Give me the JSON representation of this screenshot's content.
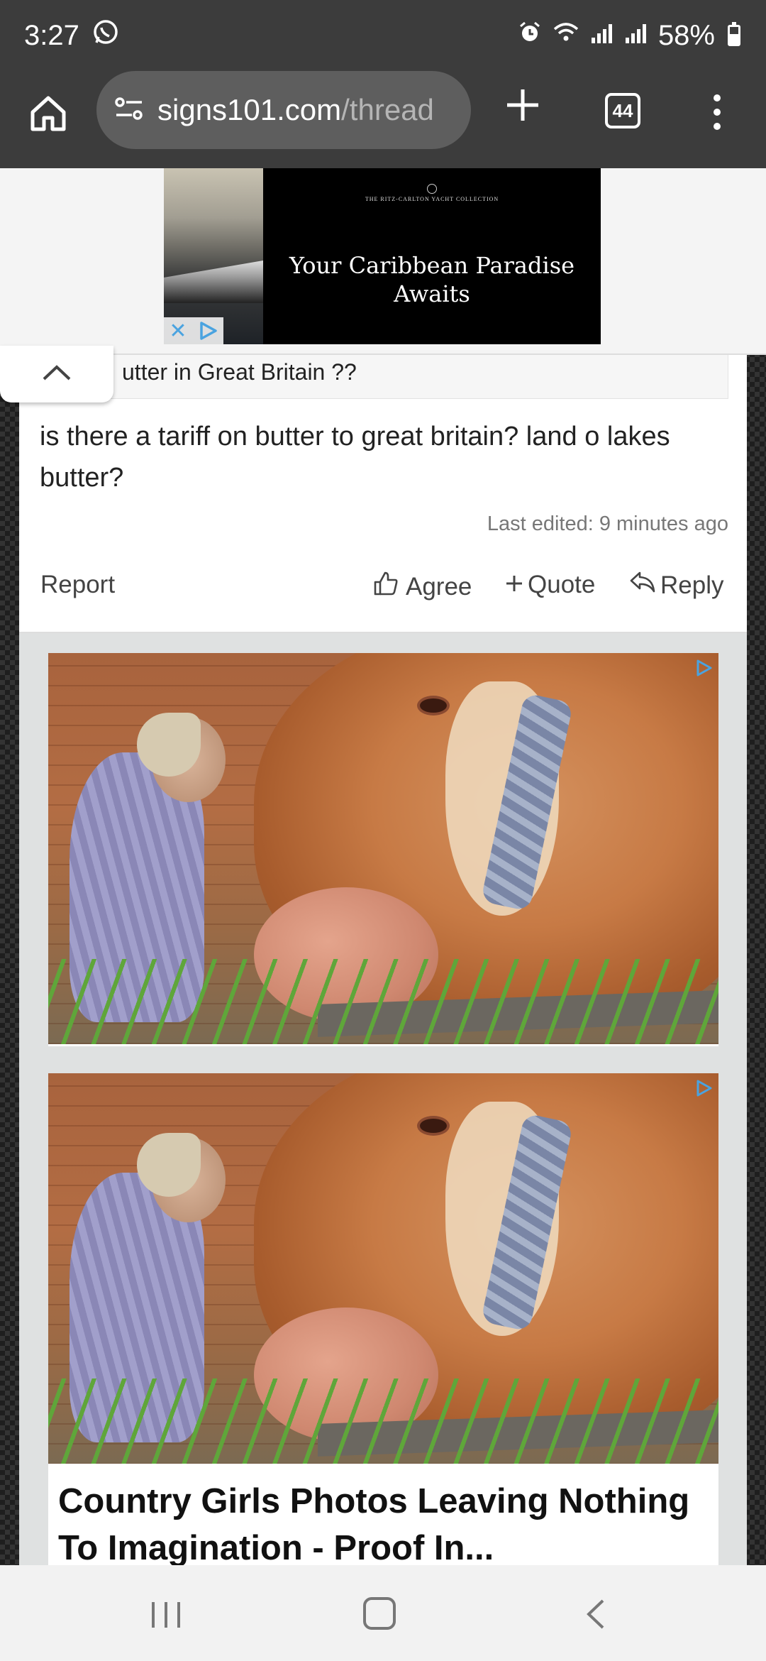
{
  "status_bar": {
    "time": "3:27",
    "battery_percent": "58%",
    "battery_level": 0.58,
    "icons": [
      "whatsapp-icon",
      "alarm-icon",
      "wifi-icon",
      "signal-icon",
      "signal-icon",
      "battery-icon"
    ]
  },
  "browser": {
    "url_host": "signs101.com",
    "url_path": "/thread",
    "tab_count": "44"
  },
  "top_ad": {
    "brand": "THE RITZ-CARLTON YACHT COLLECTION",
    "headline": "Your Caribbean Paradise Awaits"
  },
  "post": {
    "thread_title": "utter in Great Britain ??",
    "body": "is there a tariff on butter to great britain? land o lakes butter?",
    "last_edited": "Last edited: 9 minutes ago",
    "actions": {
      "report": "Report",
      "agree": "Agree",
      "quote": "Quote",
      "reply": "Reply"
    }
  },
  "ads": {
    "headline": "Country Girls Photos Leaving Nothing To Imagination - Proof In..."
  },
  "colors": {
    "toolbar": "#3c3c3c",
    "url_pill": "#5e5e5e",
    "adchoice_blue": "#4aa3e0"
  }
}
